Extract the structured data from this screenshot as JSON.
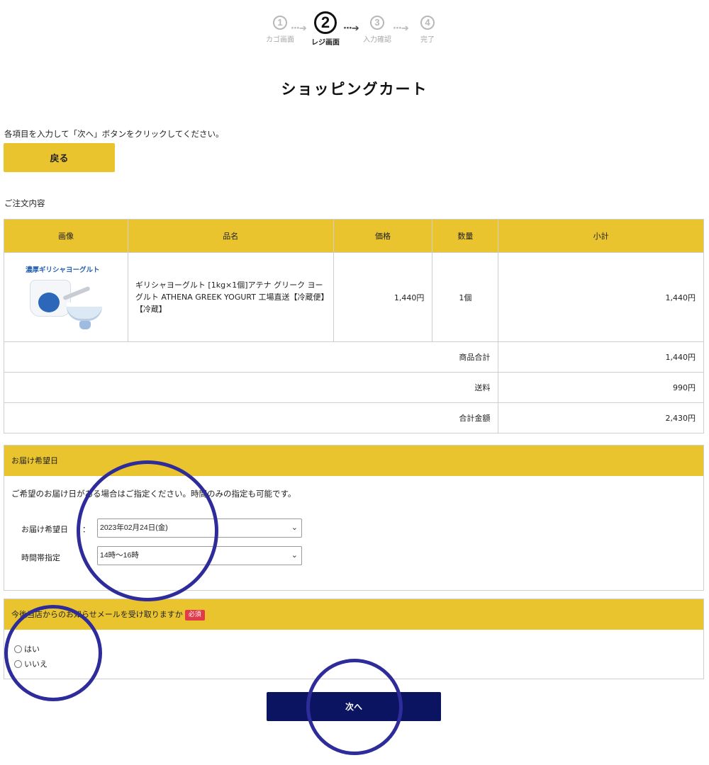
{
  "steps": [
    {
      "num": "1",
      "label": "カゴ画面",
      "active": false
    },
    {
      "num": "2",
      "label": "レジ画面",
      "active": true
    },
    {
      "num": "3",
      "label": "入力確認",
      "active": false
    },
    {
      "num": "4",
      "label": "完了",
      "active": false
    }
  ],
  "step_arrow": "···➔",
  "page_title": "ショッピングカート",
  "instruction": "各項目を入力して「次へ」ボタンをクリックしてください。",
  "back_button": "戻る",
  "order_section_label": "ご注文内容",
  "table": {
    "headers": [
      "画像",
      "品名",
      "価格",
      "数量",
      "小計"
    ],
    "product": {
      "image_caption": "濃厚ギリシャヨーグルト",
      "name": "ギリシャヨーグルト [1kg×1個]アテナ グリーク ヨーグルト ATHENA GREEK YOGURT 工場直送【冷蔵便】【冷蔵】",
      "price": "1,440円",
      "quantity": "1個",
      "subtotal": "1,440円"
    },
    "summary": [
      {
        "label": "商品合計",
        "value": "1,440円"
      },
      {
        "label": "送料",
        "value": "990円"
      },
      {
        "label": "合計金額",
        "value": "2,430円"
      }
    ]
  },
  "delivery": {
    "title": "お届け希望日",
    "note": "ご希望のお届け日がある場合はご指定ください。時間のみの指定も可能です。",
    "date_label": "お届け希望日",
    "colon": "：",
    "date_value": "2023年02月24日(金)",
    "time_label": "時間帯指定",
    "time_value": "14時〜16時"
  },
  "newsletter": {
    "title": "今後当店からのお知らせメールを受け取りますか",
    "required_badge": "必須",
    "options": [
      "はい",
      "いいえ"
    ]
  },
  "next_button": "次へ",
  "colors": {
    "accent_yellow": "#e9c42e",
    "next_button": "#0b1461",
    "annotation_circle": "#2e2b9a",
    "required_badge": "#e23a4b"
  },
  "icons": {
    "select_chevron": "chevron-down-icon"
  }
}
